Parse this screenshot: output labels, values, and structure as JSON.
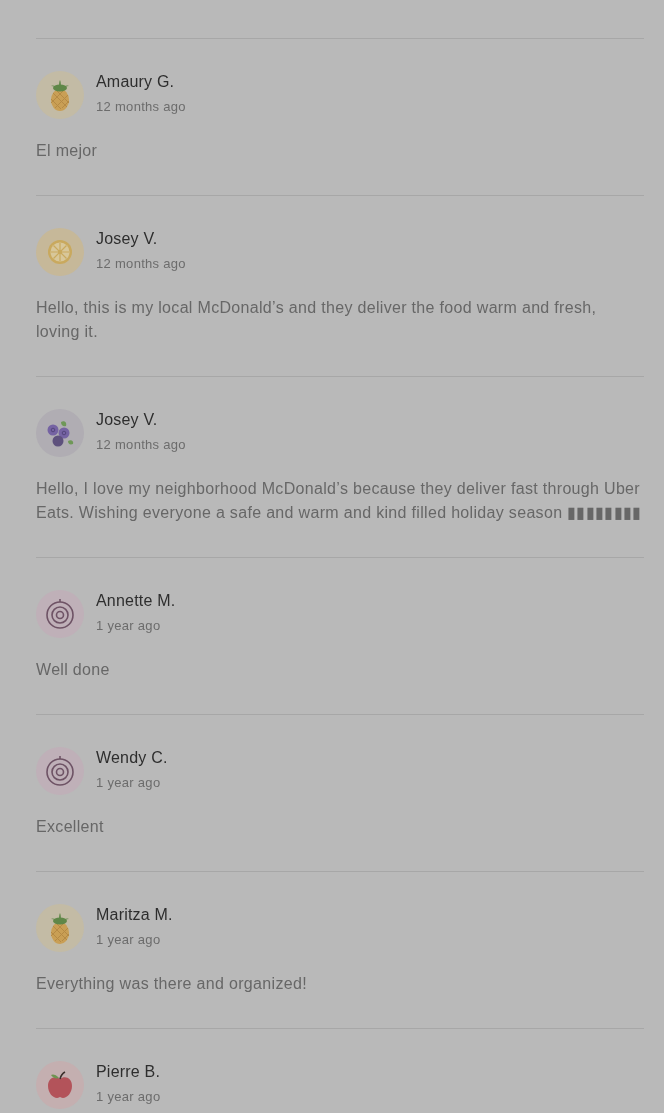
{
  "reviews": [
    {
      "name": "Amaury G.",
      "time": "12 months ago",
      "comment": "El mejor",
      "avatar": {
        "kind": "pineapple"
      }
    },
    {
      "name": "Josey V.",
      "time": "12 months ago",
      "comment": "Hello, this is my local McDonald’s and they deliver the food warm and fresh, loving it.",
      "avatar": {
        "kind": "lemon"
      }
    },
    {
      "name": "Josey V.",
      "time": "12 months ago",
      "comment": "Hello, I love my neighborhood McDonald’s because they deliver fast through Uber Eats. Wishing everyone a safe and warm and kind filled holiday season ▮▮▮▮▮▮▮▮",
      "avatar": {
        "kind": "blueberry"
      }
    },
    {
      "name": "Annette M.",
      "time": "1 year ago",
      "comment": "Well done",
      "avatar": {
        "kind": "onion"
      }
    },
    {
      "name": "Wendy C.",
      "time": "1 year ago",
      "comment": "Excellent",
      "avatar": {
        "kind": "onion"
      }
    },
    {
      "name": "Maritza M.",
      "time": "1 year ago",
      "comment": "Everything was there and organized!",
      "avatar": {
        "kind": "pineapple"
      }
    },
    {
      "name": "Pierre B.",
      "time": "1 year ago",
      "avatar": {
        "kind": "apple"
      }
    }
  ]
}
